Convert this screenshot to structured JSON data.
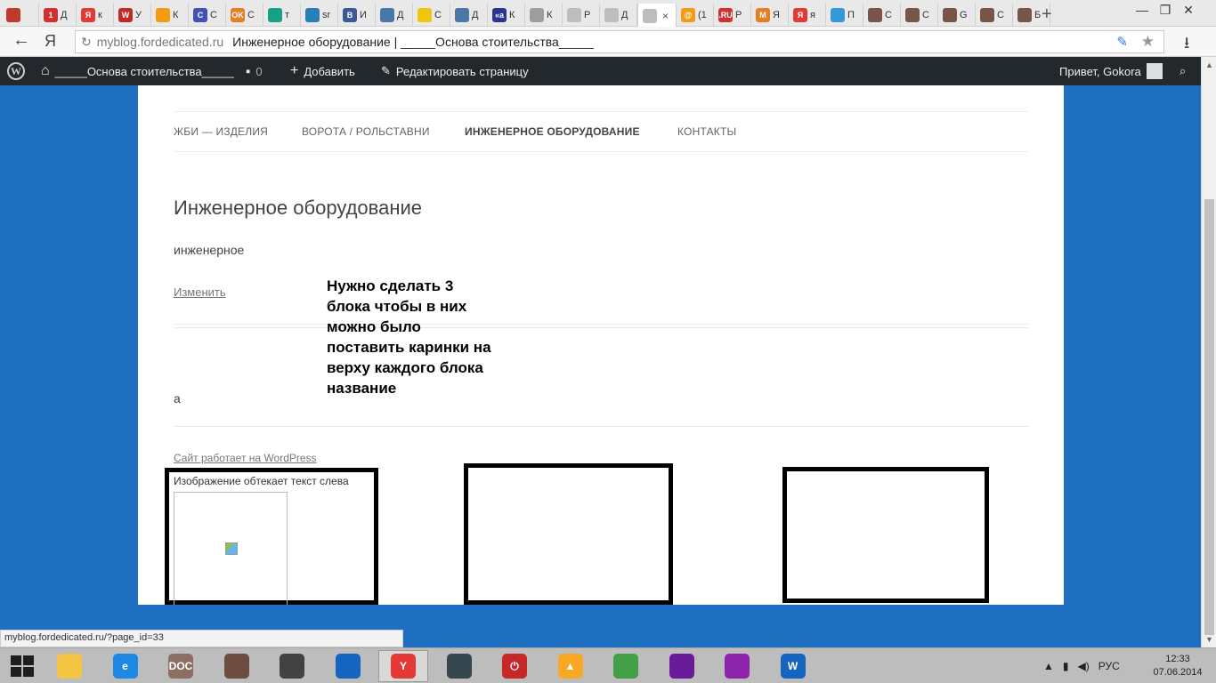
{
  "browser": {
    "tabs": [
      {
        "title": "",
        "favicon": "red-chart-icon",
        "color": "#c0392b"
      },
      {
        "title": "Д",
        "favicon": "one-icon",
        "color": "#d32f2f"
      },
      {
        "title": "к",
        "favicon": "yandex-icon",
        "color": "#e53935"
      },
      {
        "title": "У",
        "favicon": "wp-icon",
        "color": "#c62828"
      },
      {
        "title": "К",
        "favicon": "gear-icon",
        "color": "#f39c12"
      },
      {
        "title": "С",
        "favicon": "c-icon",
        "color": "#3f51b5"
      },
      {
        "title": "С",
        "favicon": "ok-icon",
        "color": "#e67e22"
      },
      {
        "title": "т",
        "favicon": "hex-icon",
        "color": "#16a085"
      },
      {
        "title": "sr",
        "favicon": "arrows-icon",
        "color": "#2980b9"
      },
      {
        "title": "И",
        "favicon": "b-icon",
        "color": "#3b5998"
      },
      {
        "title": "Д",
        "favicon": "chat-icon",
        "color": "#4a76a8"
      },
      {
        "title": "С",
        "favicon": "leaf-icon",
        "color": "#f1c40f"
      },
      {
        "title": "Д",
        "favicon": "chat-icon",
        "color": "#4a76a8"
      },
      {
        "title": "К",
        "favicon": "ka-icon",
        "color": "#283593"
      },
      {
        "title": "К",
        "favicon": "link-icon",
        "color": "#9e9e9e"
      },
      {
        "title": "Р",
        "favicon": "page-icon",
        "color": "#bdbdbd"
      },
      {
        "title": "Д",
        "favicon": "page-icon",
        "color": "#bdbdbd"
      },
      {
        "title": "",
        "favicon": "page-icon",
        "color": "#bdbdbd",
        "active": true
      },
      {
        "title": "(1",
        "favicon": "at-icon",
        "color": "#f39c12"
      },
      {
        "title": "Р",
        "favicon": "ru-icon",
        "color": "#d32f2f"
      },
      {
        "title": "Я",
        "favicon": "m-icon",
        "color": "#e67e22"
      },
      {
        "title": "я",
        "favicon": "yandex-icon",
        "color": "#e53935"
      },
      {
        "title": "П",
        "favicon": "people-icon",
        "color": "#3498db"
      },
      {
        "title": "С",
        "favicon": "user-icon",
        "color": "#795548"
      },
      {
        "title": "С",
        "favicon": "user-icon",
        "color": "#795548"
      },
      {
        "title": "G",
        "favicon": "user-icon",
        "color": "#795548"
      },
      {
        "title": "С",
        "favicon": "user-icon",
        "color": "#795548"
      },
      {
        "title": "Б",
        "favicon": "user-icon",
        "color": "#795548"
      }
    ],
    "fav_letters": [
      "",
      "1",
      "Я",
      "W",
      "",
      "C",
      "OK",
      "",
      "",
      "B",
      "",
      "",
      "",
      "«a",
      "",
      "",
      "",
      "",
      "@",
      ".RU",
      "M",
      "Я",
      "",
      "",
      "",
      "",
      "",
      ""
    ],
    "url_host": "myblog.fordedicated.ru",
    "page_title": "Инженерное оборудование | _____Основа стоительства_____",
    "new_tab": "+",
    "status_url": "myblog.fordedicated.ru/?page_id=33"
  },
  "wpbar": {
    "site_name": "_____Основа стоительства_____",
    "comments_count": "0",
    "add_label": "Добавить",
    "edit_label": "Редактировать страницу",
    "greeting": "Привет, Gokora"
  },
  "nav": {
    "items": [
      {
        "label": "ЖБИ — ИЗДЕЛИЯ"
      },
      {
        "label": "ВОРОТА / РОЛЬСТАВНИ"
      },
      {
        "label": "ИНЖЕНЕРНОЕ ОБОРУДОВАНИЕ",
        "current": true
      },
      {
        "label": "КОНТАКТЫ"
      }
    ]
  },
  "content": {
    "title": "Инженерное оборудование",
    "text": "инженерное",
    "edit_link": "Изменить",
    "sidebar_text": "а",
    "footer_link": "Сайт работает на WordPress",
    "box1_caption": "Изображение обтекает текст слева"
  },
  "annotation": "Нужно сделать 3 блока чтобы в них можно было поставить каринки на верху каждого блока название",
  "taskbar": {
    "items": [
      {
        "name": "explorer-icon",
        "color": "#f4c542"
      },
      {
        "name": "ie-icon",
        "color": "#1e88e5",
        "label": "e"
      },
      {
        "name": "doc-viewer-icon",
        "color": "#8d6e63",
        "label": "DOC"
      },
      {
        "name": "camera-icon",
        "color": "#6d4c41"
      },
      {
        "name": "speaker-icon",
        "color": "#424242"
      },
      {
        "name": "control-panel-icon",
        "color": "#1565c0"
      },
      {
        "name": "yandex-browser-icon",
        "color": "#e53935",
        "label": "Y",
        "active": true
      },
      {
        "name": "game-icon",
        "color": "#37474f"
      },
      {
        "name": "power-icon",
        "color": "#c62828",
        "label": "⏻"
      },
      {
        "name": "aimp-icon",
        "color": "#f9a825",
        "label": "▲"
      },
      {
        "name": "chrome-icon",
        "color": "#43a047"
      },
      {
        "name": "winrar-icon",
        "color": "#6a1b9a"
      },
      {
        "name": "paint-icon",
        "color": "#8e24aa"
      },
      {
        "name": "word-icon",
        "color": "#1565c0",
        "label": "W"
      }
    ],
    "lang": "РУС",
    "time": "12:33",
    "date": "07.06.2014"
  }
}
